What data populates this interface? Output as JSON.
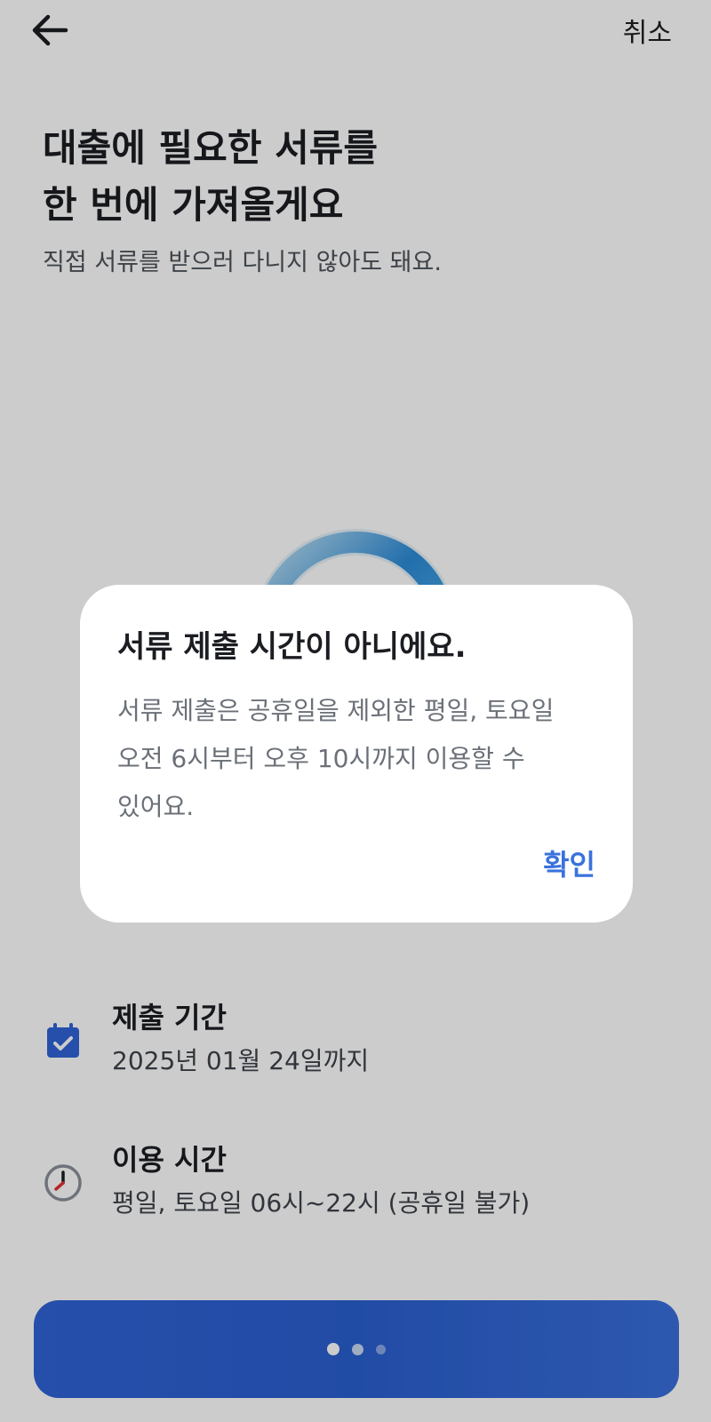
{
  "topbar": {
    "back_icon": "arrow-left-icon",
    "cancel_label": "취소"
  },
  "main": {
    "headline_line1": "대출에 필요한 서류를",
    "headline_line2": "한 번에 가져올게요",
    "subtitle": "직접 서류를 받으러 다니지 않아도 돼요."
  },
  "info": {
    "period": {
      "icon": "calendar-check-icon",
      "label": "제출 기간",
      "value": "2025년 01월 24일까지"
    },
    "hours": {
      "icon": "clock-icon",
      "label": "이용 시간",
      "value": "평일, 토요일 06시~22시 (공휴일 불가)"
    }
  },
  "primary_button": {
    "state": "loading",
    "dots": 3
  },
  "dialog": {
    "title": "서류 제출 시간이 아니에요.",
    "body_line1": "서류 제출은 공휴일을 제외한 평일, 토요일",
    "body_line2": "오전 6시부터 오후 10시까지 이용할 수",
    "body_line3": "있어요.",
    "confirm_label": "확인"
  },
  "colors": {
    "accent": "#2f63d6",
    "link": "#3a72dd",
    "overlay": "rgba(0,0,0,0.20)"
  }
}
